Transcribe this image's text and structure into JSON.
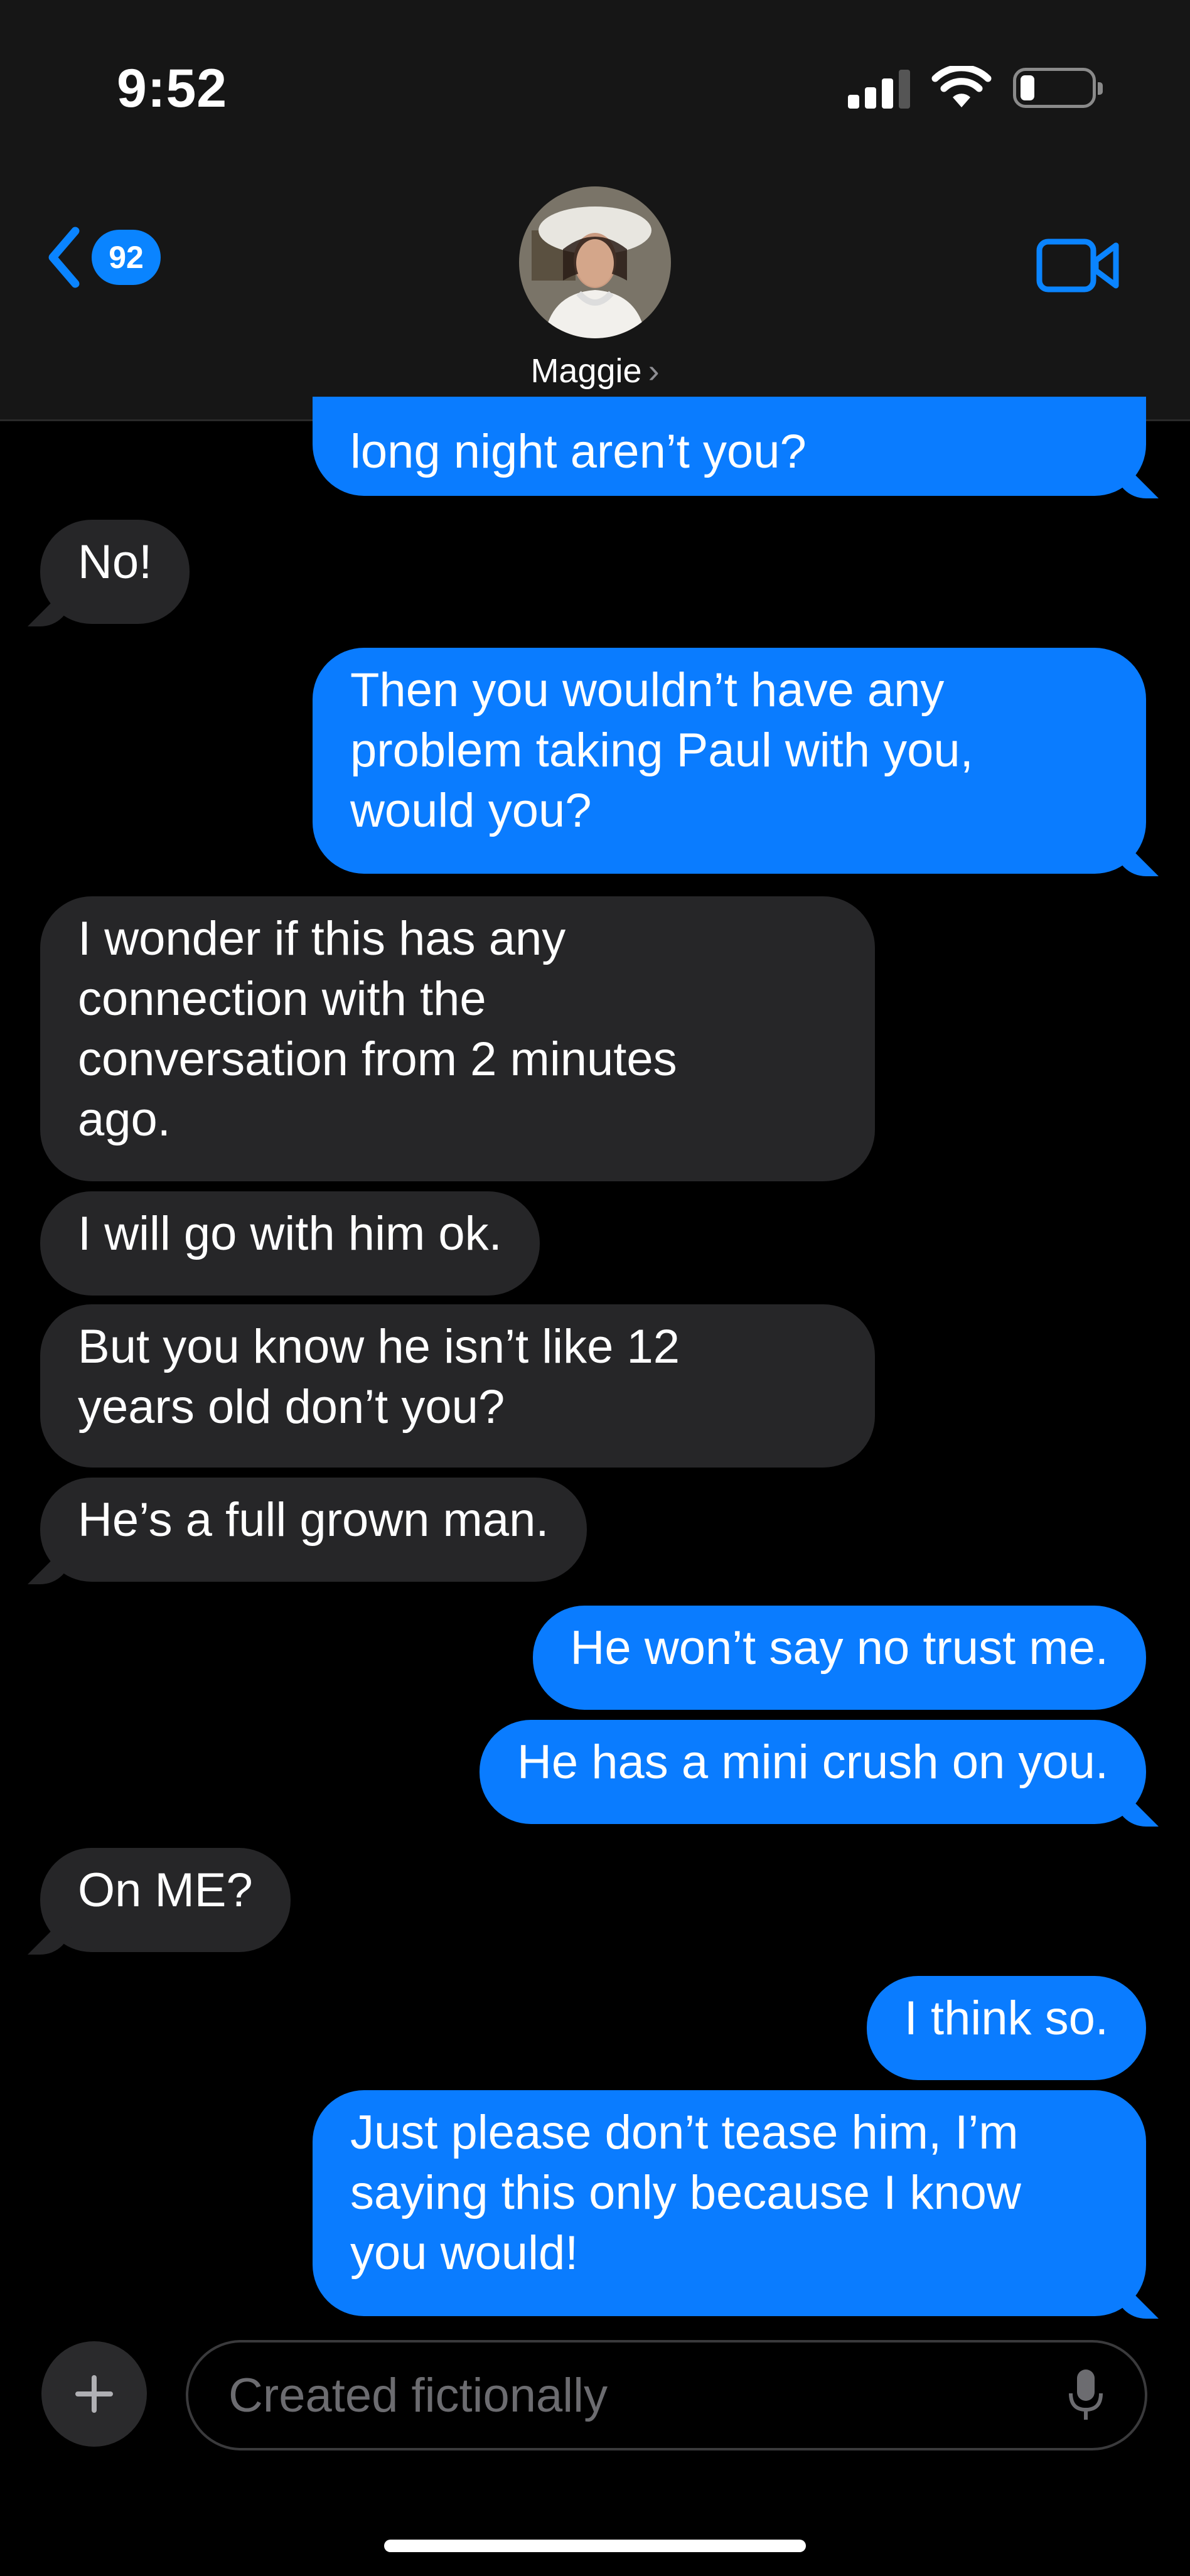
{
  "status_bar": {
    "time": "9:52"
  },
  "header": {
    "back_count": "92",
    "contact_name": "Maggie",
    "contact_chevron": "›"
  },
  "messages": [
    {
      "from": "me",
      "text": "long night aren’t you?"
    },
    {
      "from": "them",
      "text": "No!"
    },
    {
      "from": "me",
      "lines": [
        "Then you wouldn’t have any",
        "problem taking Paul with you,",
        "would you?"
      ]
    },
    {
      "from": "them",
      "lines": [
        "I wonder if this has any",
        "connection with the",
        "conversation from 2 minutes",
        "ago."
      ]
    },
    {
      "from": "them",
      "text": "I will go with him ok."
    },
    {
      "from": "them",
      "lines": [
        "But you know he isn’t like 12",
        "years old don’t you?"
      ]
    },
    {
      "from": "them",
      "text": "He’s a full grown man."
    },
    {
      "from": "me",
      "text": "He won’t say no trust me."
    },
    {
      "from": "me",
      "text": "He has a mini crush on you."
    },
    {
      "from": "them",
      "text": "On ME?"
    },
    {
      "from": "me",
      "text": "I think so."
    },
    {
      "from": "me",
      "lines": [
        "Just please don’t tease him, I’m",
        "saying this only because I know",
        "you would!"
      ]
    }
  ],
  "composer": {
    "placeholder": "Created fictionally"
  },
  "colors": {
    "sent_bubble": "#0a7cff",
    "received_bubble": "#262628",
    "accent": "#0a84ff"
  },
  "icons": [
    "back-chevron-icon",
    "video-call-icon",
    "plus-icon",
    "microphone-icon",
    "cellular-signal-icon",
    "wifi-icon",
    "battery-icon"
  ]
}
